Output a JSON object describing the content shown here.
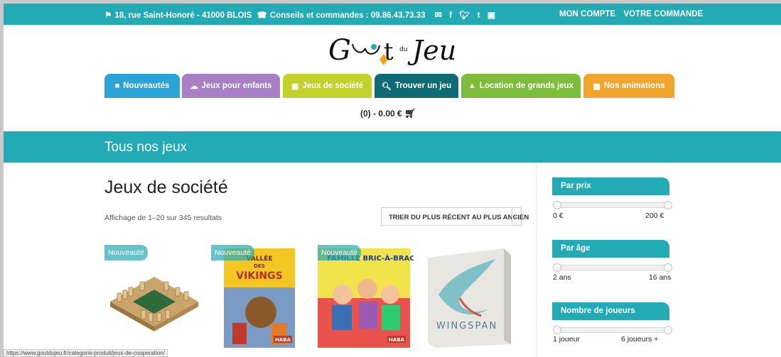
{
  "topbar": {
    "address": "18, rue Saint-Honoré - 41000 BLOIS",
    "phone": "Conseils et commandes : 09.86.43.73.33",
    "account": "MON COMPTE",
    "order": "VOTRE COMMANDE",
    "social_icons": [
      "mail-icon",
      "facebook-icon",
      "twitter-icon",
      "tumblr-icon",
      "flickr-icon"
    ]
  },
  "logo": {
    "text_main": "Gt",
    "text_du": "du",
    "text_jeu": "Jeu"
  },
  "nav": [
    {
      "label": "Nouveautés",
      "icon": "bookmark-icon",
      "color": "#2aa4d6"
    },
    {
      "label": "Jeux pour enfants",
      "icon": "cloud-icon",
      "color": "#a77fc4"
    },
    {
      "label": "Jeux de société",
      "icon": "puzzle-icon",
      "color": "#c3d12b"
    },
    {
      "label": "Trouver un jeu",
      "icon": "search-icon",
      "color": "#0f6a73"
    },
    {
      "label": "Location de grands jeux",
      "icon": "shapes-icon",
      "color": "#7dbd3b"
    },
    {
      "label": "Nos animations",
      "icon": "calendar-icon",
      "color": "#f1a52f"
    }
  ],
  "cart": {
    "text": "(0) - 0.00 €",
    "icon": "cart-icon"
  },
  "banner": {
    "title": "Tous nos jeux"
  },
  "main": {
    "heading": "Jeux de société",
    "count": "Affichage de 1–20 sur 345 resultats",
    "sort_label": "TRIER DU PLUS RÉCENT AU PLUS ANCIEN"
  },
  "products": [
    {
      "badge": "Nouveauté",
      "title": ""
    },
    {
      "badge": "Nouveauté",
      "title": "Vallée des Vikings",
      "brand": "HABA"
    },
    {
      "badge": "Nouveauté",
      "title": "Famille Bric-à-Brac",
      "brand": "HABA"
    },
    {
      "badge": "",
      "title": "WINGSPAN"
    }
  ],
  "sidebar": {
    "price": {
      "title": "Par prix",
      "min": "0 €",
      "max": "200 €"
    },
    "age": {
      "title": "Par âge",
      "min": "2 ans",
      "max": "16 ans"
    },
    "players": {
      "title": "Nombre de joueurs",
      "min": "1 joueur",
      "max": "6 joueurs +"
    }
  },
  "status_url": "https://www.goutdujeu.fr/categorie-produit/jeux-de-cooperation/",
  "colors": {
    "teal": "#22aab5"
  }
}
